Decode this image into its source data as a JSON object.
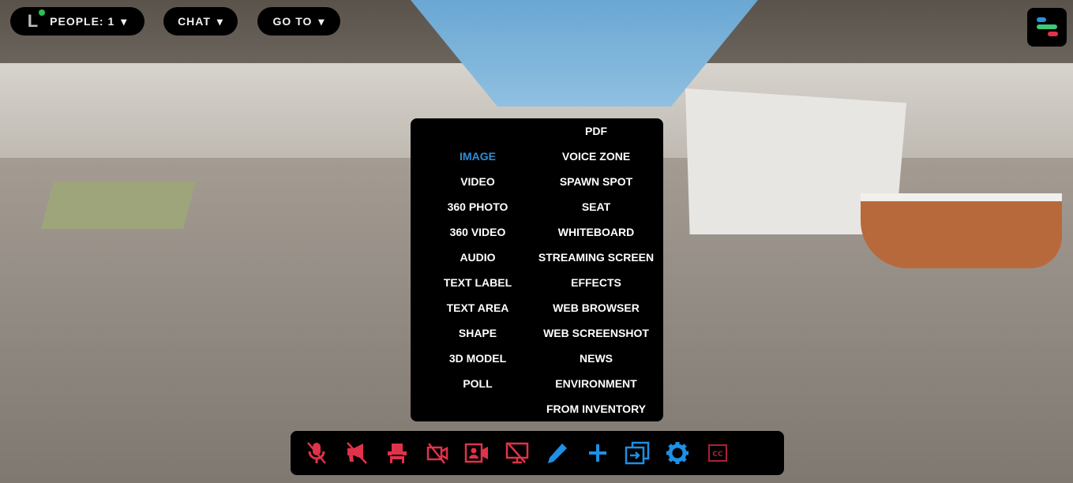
{
  "header": {
    "avatar_initial": "L",
    "people_label": "PEOPLE: 1",
    "chat_label": "CHAT",
    "goto_label": "GO TO",
    "chevron": "⌄"
  },
  "menu": {
    "left_items": [
      "IMAGE",
      "VIDEO",
      "360 PHOTO",
      "360 VIDEO",
      "AUDIO",
      "TEXT LABEL",
      "TEXT AREA",
      "SHAPE",
      "3D MODEL",
      "POLL"
    ],
    "right_items": [
      "PDF",
      "VOICE ZONE",
      "SPAWN SPOT",
      "SEAT",
      "WHITEBOARD",
      "STREAMING SCREEN",
      "EFFECTS",
      "WEB BROWSER",
      "WEB SCREENSHOT",
      "NEWS",
      "ENVIRONMENT",
      "FROM INVENTORY"
    ],
    "active": "IMAGE"
  },
  "toolbar": {
    "icons": [
      "mic-off-icon",
      "speaker-off-icon",
      "seat-icon",
      "camera-off-icon",
      "video-profile-icon",
      "screenshare-off-icon",
      "pencil-icon",
      "plus-icon",
      "copy-enter-icon",
      "gear-icon",
      "cc-icon",
      "emoji-icon"
    ],
    "cc_label": "CC",
    "emojis": [
      "😀",
      "😂",
      "😍",
      "😉"
    ]
  },
  "colors": {
    "danger": "#e0324a",
    "accent": "#1e90e6",
    "active": "#2d8fd8",
    "online": "#2fbf4f"
  }
}
